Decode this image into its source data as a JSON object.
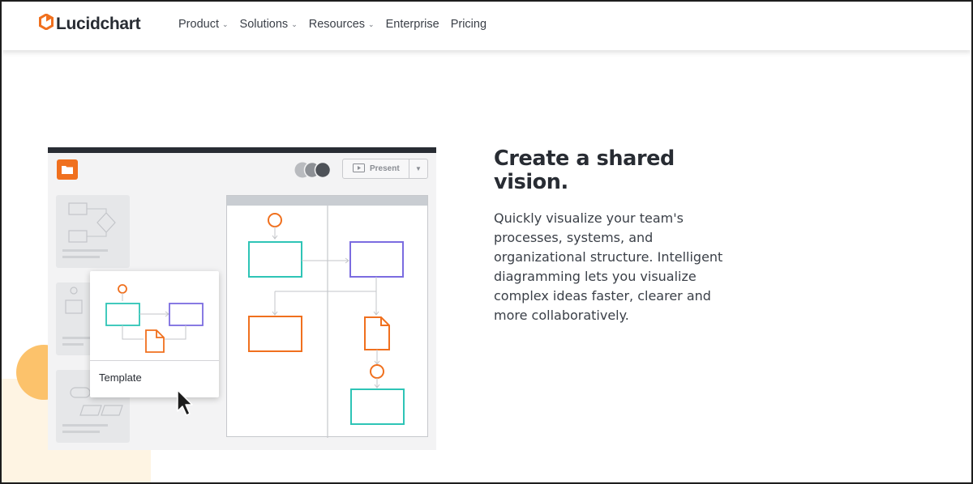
{
  "brand": {
    "name": "Lucidchart",
    "logo_color": "#f0701e"
  },
  "nav": {
    "items": [
      {
        "label": "Product",
        "has_dropdown": true
      },
      {
        "label": "Solutions",
        "has_dropdown": true
      },
      {
        "label": "Resources",
        "has_dropdown": true
      },
      {
        "label": "Enterprise",
        "has_dropdown": false
      },
      {
        "label": "Pricing",
        "has_dropdown": false
      }
    ],
    "dropdown_icon": "chevron-down-icon"
  },
  "illustration": {
    "present_label": "Present",
    "template_label": "Template",
    "colors": {
      "orange": "#f0701e",
      "teal": "#2ec4b6",
      "purple": "#7b6ce0",
      "accent_yellow": "#fcc26b"
    }
  },
  "hero": {
    "headline": "Create a shared vision.",
    "body": "Quickly visualize your team's processes, systems, and organizational structure. Intelligent diagramming lets you visualize complex ideas faster, clearer and more collaboratively."
  }
}
